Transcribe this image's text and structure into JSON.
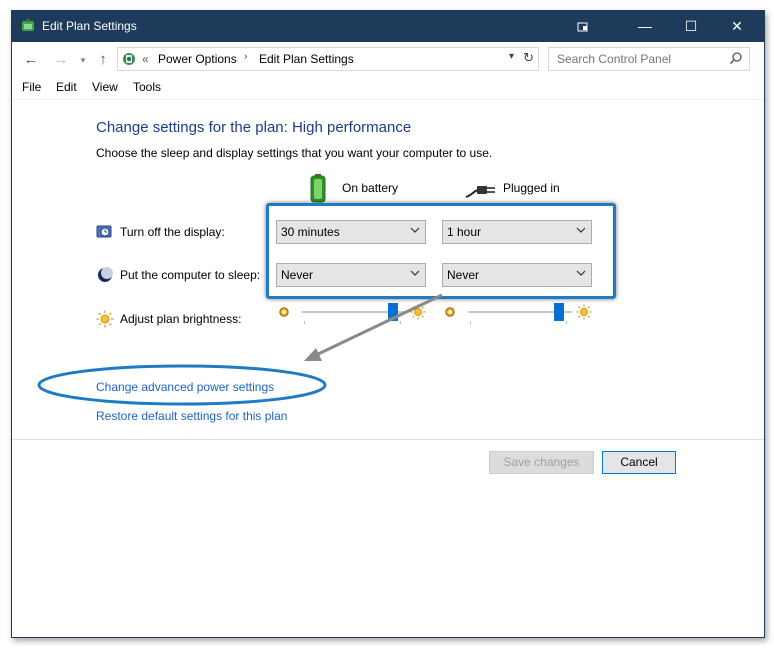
{
  "window": {
    "title": "Edit Plan Settings",
    "controls": {
      "minimize": "—",
      "maximize": "☐",
      "close": "✕"
    }
  },
  "address": {
    "overflow": "«",
    "crumbs": [
      "Power Options",
      "Edit Plan Settings"
    ],
    "search_placeholder": "Search Control Panel"
  },
  "menu": [
    "File",
    "Edit",
    "View",
    "Tools"
  ],
  "main": {
    "heading": "Change settings for the plan: High performance",
    "subtext": "Choose the sleep and display settings that you want your computer to use.",
    "columns": {
      "on_battery": "On battery",
      "plugged_in": "Plugged in"
    },
    "rows": {
      "display": {
        "label": "Turn off the display:",
        "on_battery": "30 minutes",
        "plugged_in": "1 hour"
      },
      "sleep": {
        "label": "Put the computer to sleep:",
        "on_battery": "Never",
        "plugged_in": "Never"
      },
      "brightness": {
        "label": "Adjust plan brightness:",
        "on_battery_level": 0.92,
        "plugged_in_level": 0.92
      }
    },
    "links": {
      "advanced": "Change advanced power settings",
      "restore": "Restore default settings for this plan"
    }
  },
  "buttons": {
    "save": "Save changes",
    "cancel": "Cancel"
  },
  "colors": {
    "titlebar": "#1f3b5c",
    "heading": "#1e3d87",
    "link": "#1f63c6",
    "annotation": "#1f7bc4",
    "slider": "#0a6fd3"
  }
}
